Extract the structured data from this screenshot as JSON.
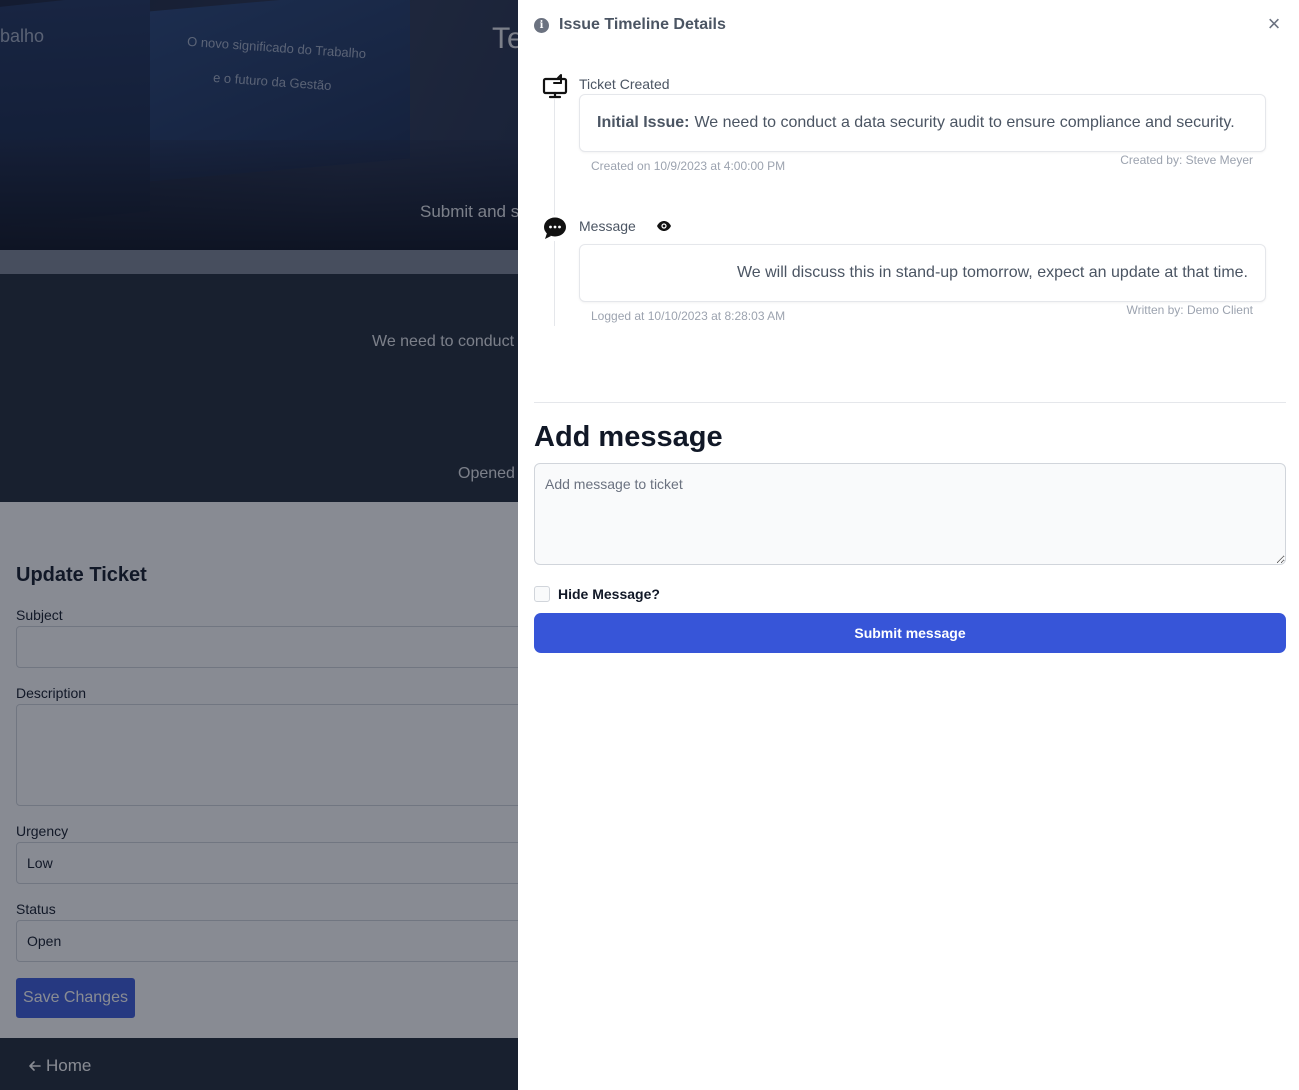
{
  "background": {
    "hero": {
      "title_partial": "Te",
      "subtitle_partial": "Submit and s",
      "banner_text_1": "balho",
      "banner_text_2": "O novo significado do Trabalho",
      "banner_text_3": "e o futuro da Gestão"
    },
    "ticket": {
      "description_partial": "We need to conduct",
      "opened_partial": "Opened"
    },
    "form": {
      "title": "Update Ticket",
      "subject_label": "Subject",
      "subject_value": "",
      "description_label": "Description",
      "description_value": "",
      "urgency_label": "Urgency",
      "urgency_value": "Low",
      "status_label": "Status",
      "status_value": "Open",
      "save_label": "Save Changes"
    },
    "footer": {
      "home_label": "Home"
    }
  },
  "drawer": {
    "title": "Issue Timeline Details",
    "close_glyph": "×",
    "timeline": [
      {
        "icon": "monitor-arrow-icon",
        "label": "Ticket Created",
        "prefix": "Initial Issue:",
        "text": "We need to conduct a data security audit to ensure compliance and security.",
        "meta": "Created on 10/9/2023 at 4:00:00 PM",
        "by": "Created by: Steve Meyer"
      },
      {
        "icon": "chat-bubble-icon",
        "label": "Message",
        "visibility_icon": "eye-icon",
        "text": "We will discuss this in stand-up tomorrow, expect an update at that time.",
        "meta": "Logged at 10/10/2023 at 8:28:03 AM",
        "by": "Written by: Demo Client"
      }
    ],
    "add_message": {
      "title": "Add message",
      "placeholder": "Add message to ticket",
      "value": "",
      "hide_label": "Hide Message?",
      "hide_checked": false,
      "submit_label": "Submit message"
    }
  },
  "colors": {
    "primary": "#3755d8",
    "dark_band": "#1f2937",
    "overlay": "rgba(17,24,39,0.5)"
  }
}
